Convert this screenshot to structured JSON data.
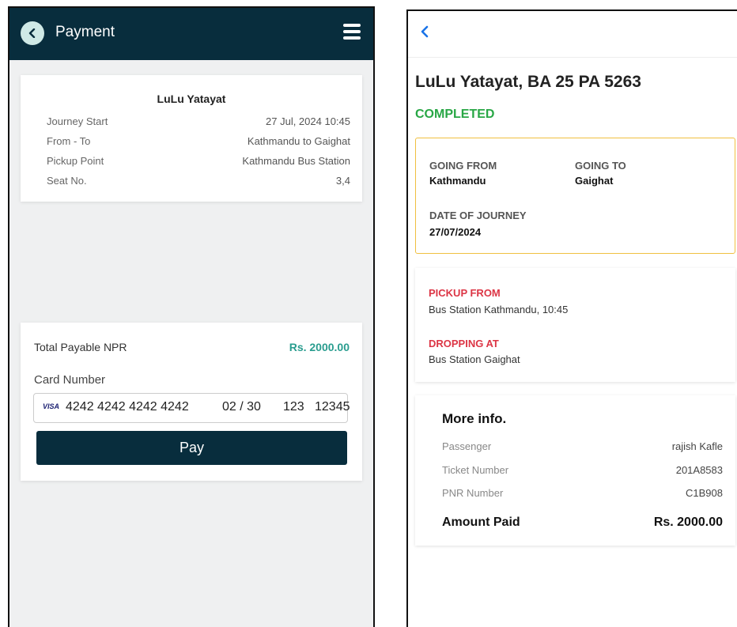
{
  "left": {
    "header": {
      "title": "Payment",
      "back_icon": "chevron-left-icon",
      "menu_icon": "hamburger-menu-icon"
    },
    "trip": {
      "operator": "LuLu Yatayat",
      "rows": [
        {
          "label": "Journey Start",
          "value": "27 Jul, 2024 10:45"
        },
        {
          "label": "From - To",
          "value": "Kathmandu to Gaighat"
        },
        {
          "label": "Pickup Point",
          "value": "Kathmandu Bus Station"
        },
        {
          "label": "Seat No.",
          "value": "3,4"
        }
      ]
    },
    "payment": {
      "total_label": "Total Payable NPR",
      "total_value": "Rs. 2000.00",
      "card_label": "Card Number",
      "card_brand": "VISA",
      "card_number": "4242 4242 4242 4242",
      "expiry": "02 / 30",
      "cvc": "123",
      "zip": "12345",
      "pay_label": "Pay"
    },
    "colors": {
      "header_bg": "#082d3d",
      "accent_green": "#2a9d8f"
    }
  },
  "right": {
    "header": {
      "back_icon": "chevron-left-icon"
    },
    "title": "LuLu Yatayat, BA 25 PA 5263",
    "status": "COMPLETED",
    "journey": {
      "from_label": "GOING FROM",
      "from_value": "Kathmandu",
      "to_label": "GOING TO",
      "to_value": "Gaighat",
      "date_label": "DATE OF JOURNEY",
      "date_value": "27/07/2024"
    },
    "pickup": {
      "pickup_label": "PICKUP FROM",
      "pickup_value": "Bus Station Kathmandu, 10:45",
      "drop_label": "DROPPING AT",
      "drop_value": "Bus Station Gaighat"
    },
    "info": {
      "title": "More info.",
      "rows": [
        {
          "label": "Passenger",
          "value": "rajish Kafle"
        },
        {
          "label": "Ticket Number",
          "value": "201A8583"
        },
        {
          "label": "PNR Number",
          "value": "C1B908"
        }
      ],
      "paid_label": "Amount Paid",
      "paid_value": "Rs. 2000.00"
    },
    "colors": {
      "status_green": "#28a745",
      "label_red": "#dc3545",
      "box_border": "#f0c040",
      "back_blue": "#1a73e8"
    }
  }
}
